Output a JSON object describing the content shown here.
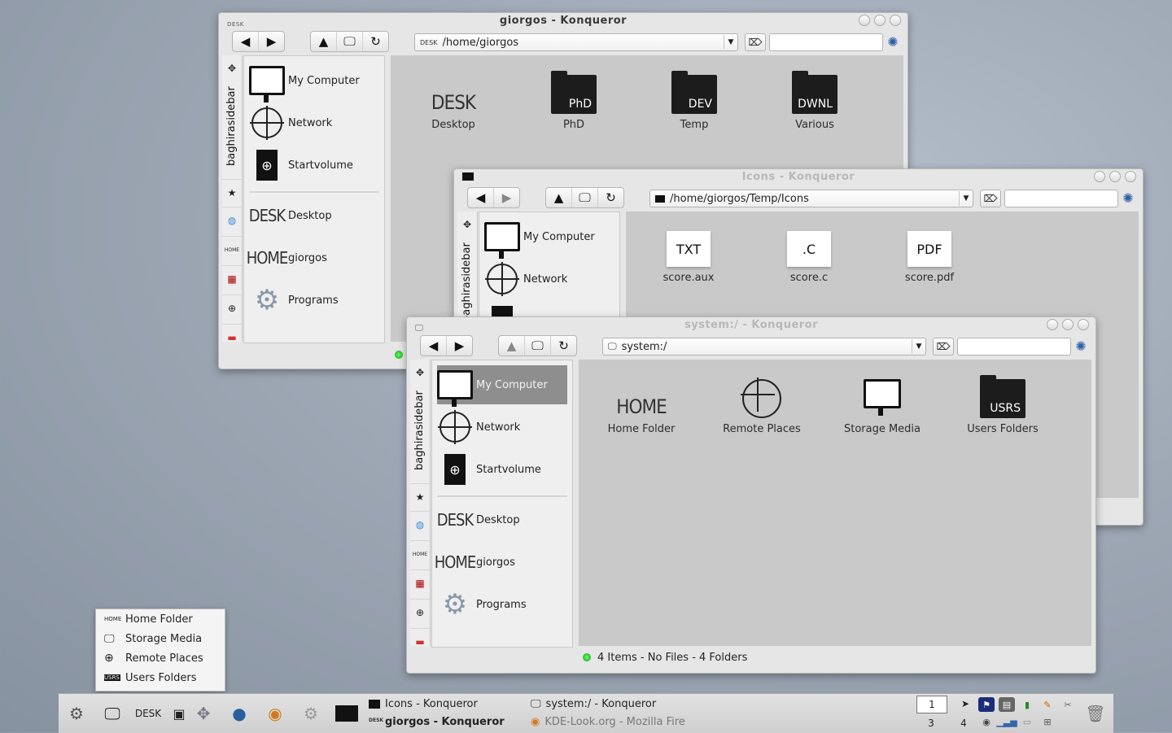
{
  "windows": {
    "giorgos": {
      "title": "giorgos - Konqueror",
      "title_icon": "DESK",
      "location": "/home/giorgos",
      "location_icon": "DESK",
      "tab_label": "baghirasidebar",
      "sidebar": [
        "My Computer",
        "Network",
        "Startvolume",
        "Desktop",
        "giorgos",
        "Programs"
      ],
      "sidebar_icon_words": {
        "desk": "DESK",
        "home": "HOME"
      },
      "files": [
        {
          "label": "Desktop",
          "icon_word": "DESK"
        },
        {
          "label": "PhD",
          "icon_word": "PhD"
        },
        {
          "label": "Temp",
          "icon_word": "DEV"
        },
        {
          "label": "Various",
          "icon_word": "DWNL"
        }
      ]
    },
    "icons": {
      "title": "Icons - Konqueror",
      "location": "/home/giorgos/Temp/Icons",
      "tab_label": "baghirasidebar",
      "sidebar": [
        "My Computer",
        "Network"
      ],
      "files": [
        {
          "label": "score.aux",
          "icon_word": "TXT"
        },
        {
          "label": "score.c",
          "icon_word": ".C"
        },
        {
          "label": "score.pdf",
          "icon_word": "PDF"
        }
      ]
    },
    "system": {
      "title": "system:/ - Konqueror",
      "location": "system:/",
      "tab_label": "baghirasidebar",
      "sidebar": [
        "My Computer",
        "Network",
        "Startvolume",
        "Desktop",
        "giorgos",
        "Programs"
      ],
      "sidebar_icon_words": {
        "desk": "DESK",
        "home": "HOME"
      },
      "files": [
        {
          "label": "Home Folder",
          "icon_word": "HOME"
        },
        {
          "label": "Remote Places",
          "icon_word": ""
        },
        {
          "label": "Storage Media",
          "icon_word": ""
        },
        {
          "label": "Users Folders",
          "icon_word": "USRS"
        }
      ],
      "status": "4 Items - No Files - 4 Folders"
    }
  },
  "popup_menu": [
    {
      "label": "Home Folder",
      "icon": "HOME"
    },
    {
      "label": "Storage Media",
      "icon": "monitor-icon"
    },
    {
      "label": "Remote Places",
      "icon": "crosshair-icon"
    },
    {
      "label": "Users Folders",
      "icon": "USRS"
    }
  ],
  "taskbar": {
    "desk_label": "DESK",
    "tasks": [
      {
        "label": "Icons - Konqueror",
        "bold": false
      },
      {
        "label": "giorgos - Konqueror",
        "bold": true
      },
      {
        "label": "system:/ - Konqueror",
        "bold": false
      },
      {
        "label": "KDE-Look.org - Mozilla Fire",
        "bold": false
      }
    ],
    "pager": [
      "1",
      "",
      "3",
      "4"
    ]
  },
  "colors": {
    "accent": "#2f5fa8",
    "selection": "#8e8e8e",
    "content_bg": "#c9c9c9"
  }
}
